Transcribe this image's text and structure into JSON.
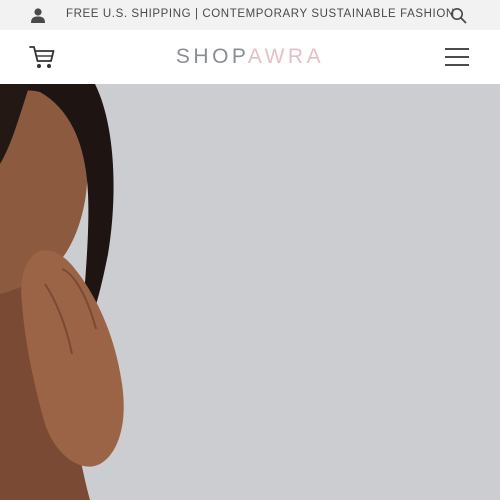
{
  "topbar": {
    "promo_text": "FREE U.S. SHIPPING | CONTEMPORARY SUSTAINABLE FASHION",
    "user_icon": "user-icon",
    "search_icon": "search-icon"
  },
  "header": {
    "logo_part1": "SHOP",
    "logo_part2": "AWRA",
    "cart_icon": "cart-icon",
    "menu_icon": "hamburger-menu-icon"
  },
  "colors": {
    "topbar_bg": "#f2f2f2",
    "logo_gray": "#8a8d92",
    "logo_pink": "#e4c0c4",
    "hero_bg": "#cbcdd1"
  }
}
